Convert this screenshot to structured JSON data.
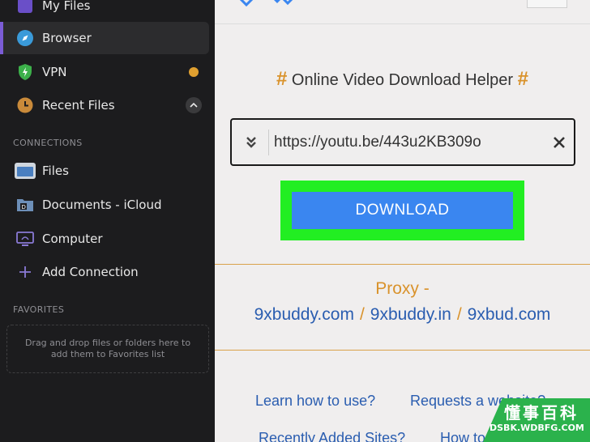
{
  "sidebar": {
    "items": [
      {
        "label": "My Files",
        "icon": "my-files-icon"
      },
      {
        "label": "Browser",
        "icon": "compass-icon"
      },
      {
        "label": "VPN",
        "icon": "shield-icon"
      },
      {
        "label": "Recent Files",
        "icon": "clock-icon"
      }
    ],
    "connections_label": "CONNECTIONS",
    "connections": [
      {
        "label": "Files",
        "icon": "folder-icon"
      },
      {
        "label": "Documents - iCloud",
        "icon": "documents-folder-icon"
      },
      {
        "label": "Computer",
        "icon": "computer-icon"
      },
      {
        "label": "Add Connection",
        "icon": "plus-icon"
      }
    ],
    "favorites_label": "FAVORITES",
    "favorites_hint": "Drag and drop files or folders here to add them to Favorites list"
  },
  "main": {
    "hash": "#",
    "heading": "Online Video Download Helper",
    "url_value": "https://youtu.be/443u2KB309o",
    "download_label": "DOWNLOAD",
    "proxy_label": "Proxy -",
    "proxy_links": [
      "9xbuddy.com",
      "9xbuddy.in",
      "9xbud.com"
    ],
    "separator": "/",
    "footer_links": [
      "Learn how to use?",
      "Requests a website?",
      "Recently Added Sites?",
      "How to"
    ]
  },
  "watermark": {
    "cn": "懂事百科",
    "en": "DSBK.WDBFG.COM"
  },
  "colors": {
    "accent": "#7b5cd6",
    "download": "#3a86f0",
    "highlight": "#22ee22",
    "orange": "#d9922b",
    "link": "#2a5db0"
  }
}
